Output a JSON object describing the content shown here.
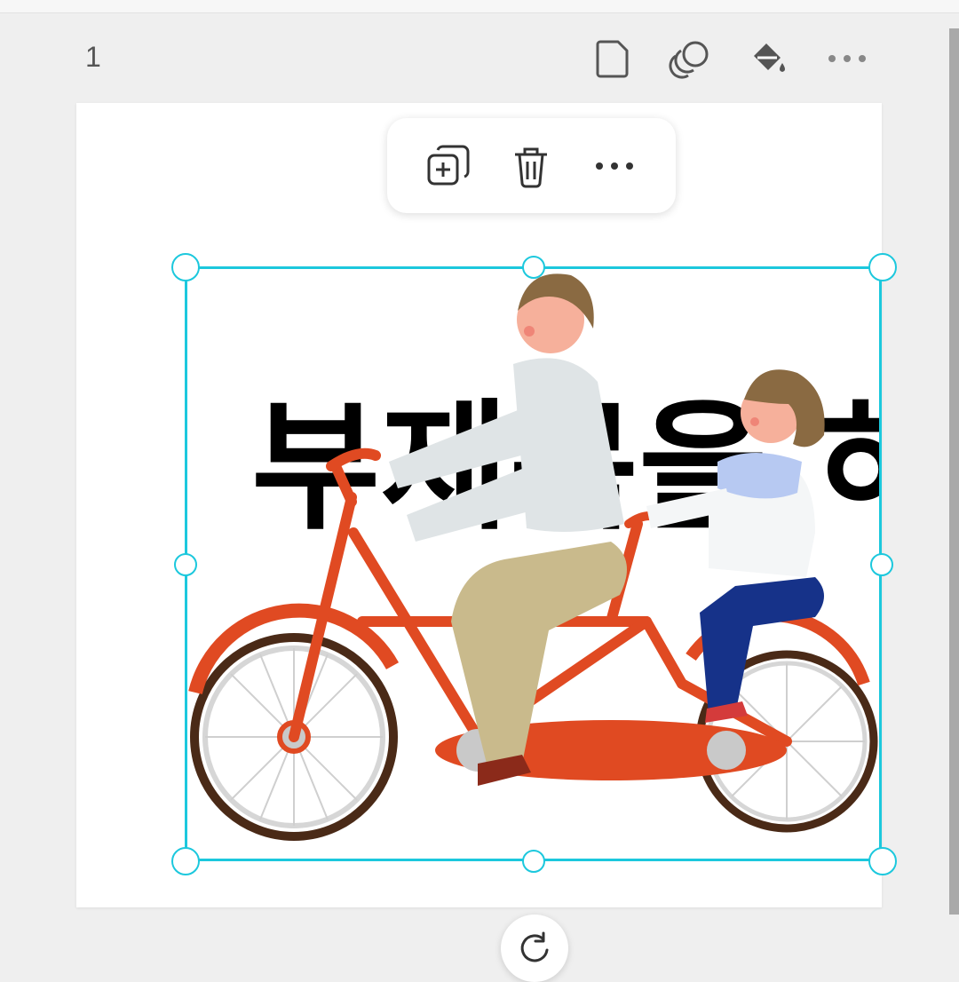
{
  "page": {
    "number": "1"
  },
  "page_tools": {
    "icons": [
      "page-icon",
      "layers-icon",
      "paint-bucket-icon",
      "more-horizontal-icon"
    ]
  },
  "context_menu": {
    "icons": [
      "duplicate-icon",
      "trash-icon",
      "more-horizontal-icon"
    ]
  },
  "canvas": {
    "headline_text": "부제목을 하",
    "illustration": "couple-riding-tandem-bicycle",
    "selection_color": "#1cc8dd"
  },
  "colors": {
    "accent": "#1cc8dd",
    "bike": "#e04a22",
    "background": "#efefef"
  }
}
